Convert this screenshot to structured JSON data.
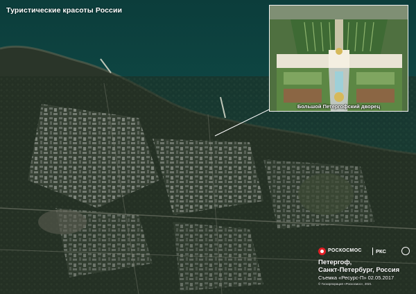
{
  "header": {
    "title": "Туристические красоты России"
  },
  "inset": {
    "caption": "Большой Петергофский дворец"
  },
  "branding": {
    "roscosmos": "РОСКОСМОС",
    "rks": "РКС"
  },
  "info": {
    "location_line1": "Петергоф,",
    "location_line2": "Санкт-Петербург, Россия",
    "shot": "Съемка «Ресурс-П» 02.05.2017",
    "copyright": "© Госкорпорация «Роскосмос», 2021"
  },
  "colors": {
    "water": "#0f4a47",
    "land": "#2b3a2c",
    "urban": "#8a8f86",
    "brand_red": "#e21f26"
  }
}
